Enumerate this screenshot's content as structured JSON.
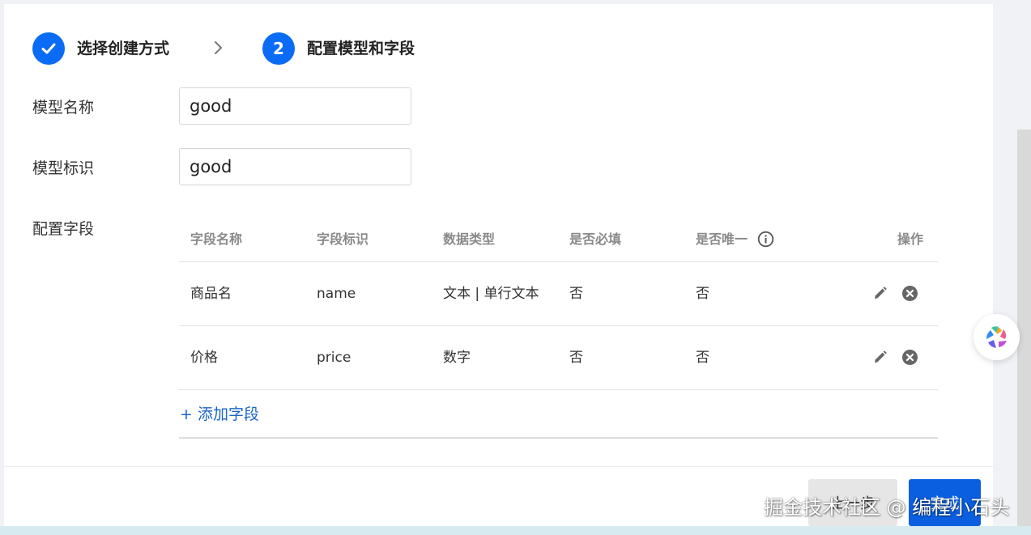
{
  "steps": [
    {
      "label": "选择创建方式",
      "state": "done"
    },
    {
      "number": "2",
      "label": "配置模型和字段",
      "state": "active"
    }
  ],
  "form": {
    "model_name_label": "模型名称",
    "model_name_value": "good",
    "model_id_label": "模型标识",
    "model_id_value": "good",
    "fields_label": "配置字段"
  },
  "table": {
    "headers": [
      "字段名称",
      "字段标识",
      "数据类型",
      "是否必填",
      "是否唯一",
      "操作"
    ],
    "rows": [
      {
        "name": "商品名",
        "identifier": "name",
        "type": "文本 | 单行文本",
        "required": "否",
        "unique": "否"
      },
      {
        "name": "价格",
        "identifier": "price",
        "type": "数字",
        "required": "否",
        "unique": "否"
      }
    ],
    "add_field": "+ 添加字段"
  },
  "footer": {
    "prev_label": "上一步",
    "done_label": "完成"
  },
  "watermark": "掘金技术社区 @ 编程小石头",
  "colors": {
    "primary": "#0a6cf5",
    "link": "#1a66c9"
  }
}
